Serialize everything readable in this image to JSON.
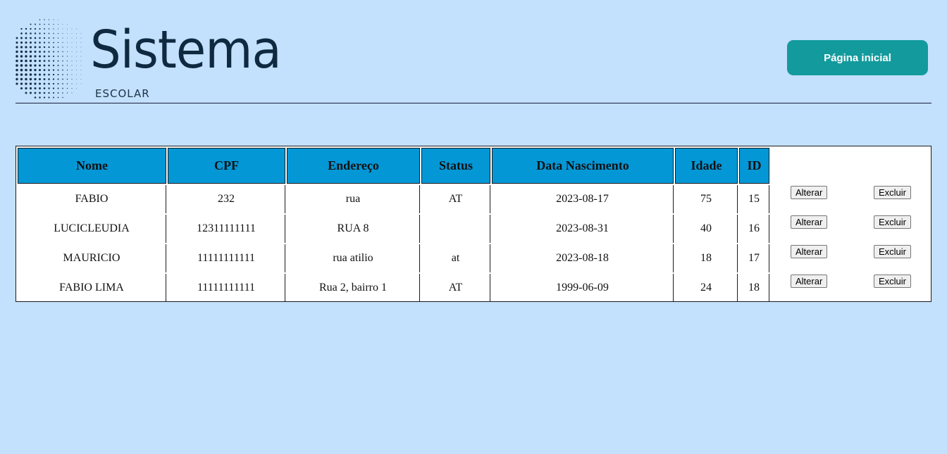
{
  "header": {
    "title": "Sistema",
    "subtitle": "ESCOLAR",
    "home_button": "Página inicial"
  },
  "colors": {
    "background": "#c3e0fd",
    "header_cell": "#0497d6",
    "primary_button": "#139a9d"
  },
  "table": {
    "columns": [
      "Nome",
      "CPF",
      "Endereço",
      "Status",
      "Data Nascimento",
      "Idade",
      "ID"
    ],
    "rows": [
      {
        "nome": "FABIO",
        "cpf": "232",
        "endereco": "rua",
        "status": "AT",
        "data": "2023-08-17",
        "idade": "75",
        "id": "15"
      },
      {
        "nome": "LUCICLEUDIA",
        "cpf": "12311111111",
        "endereco": "RUA 8",
        "status": "",
        "data": "2023-08-31",
        "idade": "40",
        "id": "16"
      },
      {
        "nome": "MAURICIO",
        "cpf": "11111111111",
        "endereco": "rua atilio",
        "status": "at",
        "data": "2023-08-18",
        "idade": "18",
        "id": "17"
      },
      {
        "nome": "FABIO LIMA",
        "cpf": "11111111111",
        "endereco": "Rua 2, bairro 1",
        "status": "AT",
        "data": "1999-06-09",
        "idade": "24",
        "id": "18"
      }
    ],
    "edit_label": "Alterar",
    "delete_label": "Excluir"
  }
}
